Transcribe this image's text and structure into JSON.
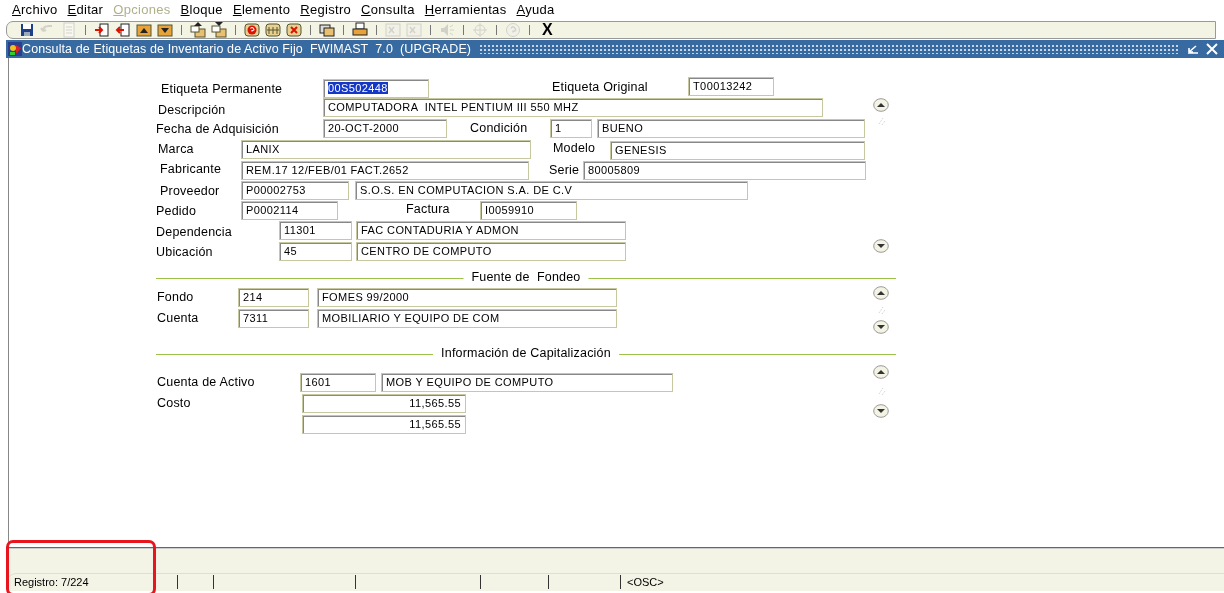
{
  "menu": [
    {
      "label": "Archivo",
      "disabled": false
    },
    {
      "label": "Editar",
      "disabled": false
    },
    {
      "label": "Opciones",
      "disabled": true
    },
    {
      "label": "Bloque",
      "disabled": false
    },
    {
      "label": "Elemento",
      "disabled": false
    },
    {
      "label": "Registro",
      "disabled": false
    },
    {
      "label": "Consulta",
      "disabled": false
    },
    {
      "label": "Herramientas",
      "disabled": false
    },
    {
      "label": "Ayuda",
      "disabled": false
    }
  ],
  "toolbar": [
    {
      "kind": "icon",
      "disabled": false
    },
    {
      "kind": "icon",
      "disabled": true
    },
    {
      "kind": "icon",
      "disabled": true
    },
    {
      "kind": "separator"
    },
    {
      "kind": "icon",
      "disabled": false
    },
    {
      "kind": "icon",
      "disabled": false
    },
    {
      "kind": "icon",
      "disabled": false
    },
    {
      "kind": "icon",
      "disabled": false
    },
    {
      "kind": "separator"
    },
    {
      "kind": "icon",
      "disabled": false
    },
    {
      "kind": "icon",
      "disabled": false
    },
    {
      "kind": "separator"
    },
    {
      "kind": "icon",
      "disabled": false
    },
    {
      "kind": "icon",
      "disabled": false
    },
    {
      "kind": "icon",
      "disabled": false
    },
    {
      "kind": "separator"
    },
    {
      "kind": "icon",
      "disabled": false
    },
    {
      "kind": "separator"
    },
    {
      "kind": "icon",
      "disabled": false
    },
    {
      "kind": "separator"
    },
    {
      "kind": "icon",
      "disabled": true
    },
    {
      "kind": "icon",
      "disabled": true
    },
    {
      "kind": "separator"
    },
    {
      "kind": "icon",
      "disabled": true
    },
    {
      "kind": "separator"
    },
    {
      "kind": "icon",
      "disabled": true
    },
    {
      "kind": "separator"
    },
    {
      "kind": "icon",
      "disabled": true
    },
    {
      "kind": "separator"
    },
    {
      "kind": "text",
      "text": "X"
    }
  ],
  "window": {
    "title": "Consulta de Etiquetas de Inventario de Activo Fijo  FWIMAST  7.0  (UPGRADE)"
  },
  "form": [
    {
      "kind": "label",
      "text": "Etiqueta Permanente"
    },
    {
      "kind": "field",
      "value": "00S502448",
      "highlighted": true
    },
    {
      "kind": "label",
      "text": "Etiqueta Original"
    },
    {
      "kind": "field",
      "value": "T00013242",
      "highlighted": false
    },
    {
      "kind": "label",
      "text": "Descripción"
    },
    {
      "kind": "field",
      "value": "COMPUTADORA  INTEL PENTIUM III 550 MHZ",
      "highlighted": false
    },
    {
      "kind": "label",
      "text": "Fecha de Adquisición"
    },
    {
      "kind": "field",
      "value": "20-OCT-2000",
      "highlighted": false
    },
    {
      "kind": "label",
      "text": "Condición"
    },
    {
      "kind": "field",
      "value": "1",
      "highlighted": false
    },
    {
      "kind": "field",
      "value": "BUENO",
      "highlighted": false
    },
    {
      "kind": "label",
      "text": "Marca"
    },
    {
      "kind": "field",
      "value": "LANIX",
      "highlighted": false
    },
    {
      "kind": "label",
      "text": "Modelo"
    },
    {
      "kind": "field",
      "value": "GENESIS",
      "highlighted": false
    },
    {
      "kind": "label",
      "text": "Fabricante"
    },
    {
      "kind": "field",
      "value": "REM.17 12/FEB/01 FACT.2652",
      "highlighted": false
    },
    {
      "kind": "label",
      "text": "Serie"
    },
    {
      "kind": "field",
      "value": "80005809",
      "highlighted": false
    },
    {
      "kind": "label",
      "text": "Proveedor"
    },
    {
      "kind": "field",
      "value": "P00002753",
      "highlighted": false
    },
    {
      "kind": "field",
      "value": "S.O.S. EN COMPUTACION S.A. DE C.V",
      "highlighted": false
    },
    {
      "kind": "label",
      "text": "Pedido"
    },
    {
      "kind": "field",
      "value": "P0002114",
      "highlighted": false
    },
    {
      "kind": "label",
      "text": "Factura"
    },
    {
      "kind": "field",
      "value": "I0059910",
      "highlighted": false
    },
    {
      "kind": "label",
      "text": "Dependencia"
    },
    {
      "kind": "field",
      "value": "11301",
      "highlighted": false
    },
    {
      "kind": "field",
      "value": "FAC CONTADURIA Y ADMON",
      "highlighted": false
    },
    {
      "kind": "label",
      "text": "Ubicación"
    },
    {
      "kind": "field",
      "value": "45",
      "highlighted": false
    },
    {
      "kind": "field",
      "value": "CENTRO DE COMPUTO",
      "highlighted": false
    },
    {
      "kind": "heading",
      "text": "Fuente de  Fondeo"
    },
    {
      "kind": "label",
      "text": "Fondo"
    },
    {
      "kind": "field",
      "value": "214",
      "highlighted": false
    },
    {
      "kind": "field",
      "value": "FOMES 99/2000",
      "highlighted": false
    },
    {
      "kind": "label",
      "text": "Cuenta"
    },
    {
      "kind": "field",
      "value": "7311",
      "highlighted": false
    },
    {
      "kind": "field",
      "value": "MOBILIARIO Y EQUIPO DE COM",
      "highlighted": false
    },
    {
      "kind": "heading",
      "text": "Información de Capitalización"
    },
    {
      "kind": "label",
      "text": "Cuenta de Activo"
    },
    {
      "kind": "field",
      "value": "1601",
      "highlighted": false
    },
    {
      "kind": "field",
      "value": "MOB Y EQUIPO DE COMPUTO",
      "highlighted": false
    },
    {
      "kind": "label",
      "text": "Costo"
    },
    {
      "kind": "amount",
      "value": "11,565.55",
      "highlighted": false
    },
    {
      "kind": "amount",
      "value": "11,565.55",
      "highlighted": false
    }
  ],
  "status_bar": [
    {
      "text": "Registro: 7/224"
    },
    {
      "text": "<OSC>"
    }
  ]
}
